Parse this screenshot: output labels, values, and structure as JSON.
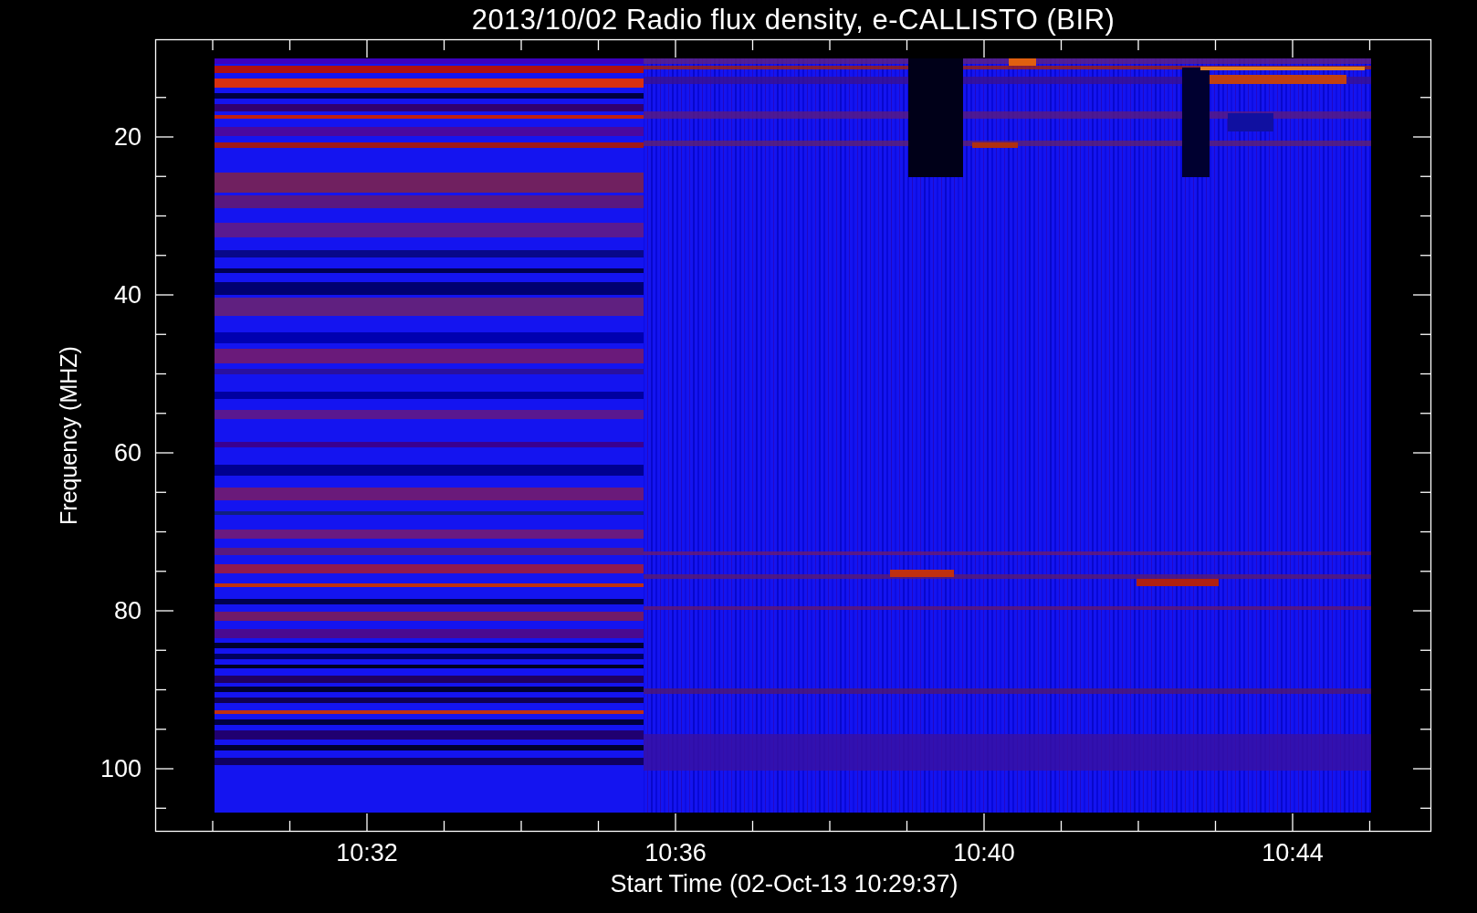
{
  "title": "2013/10/02  Radio flux density, e-CALLISTO (BIR)",
  "y_axis": {
    "label": "Frequency (MHZ)",
    "ticks": [
      "20",
      "40",
      "60",
      "80",
      "100"
    ]
  },
  "x_axis": {
    "label": "Start Time (02-Oct-13 10:29:37)",
    "ticks": [
      "10:32",
      "10:36",
      "10:40",
      "10:44"
    ]
  }
}
